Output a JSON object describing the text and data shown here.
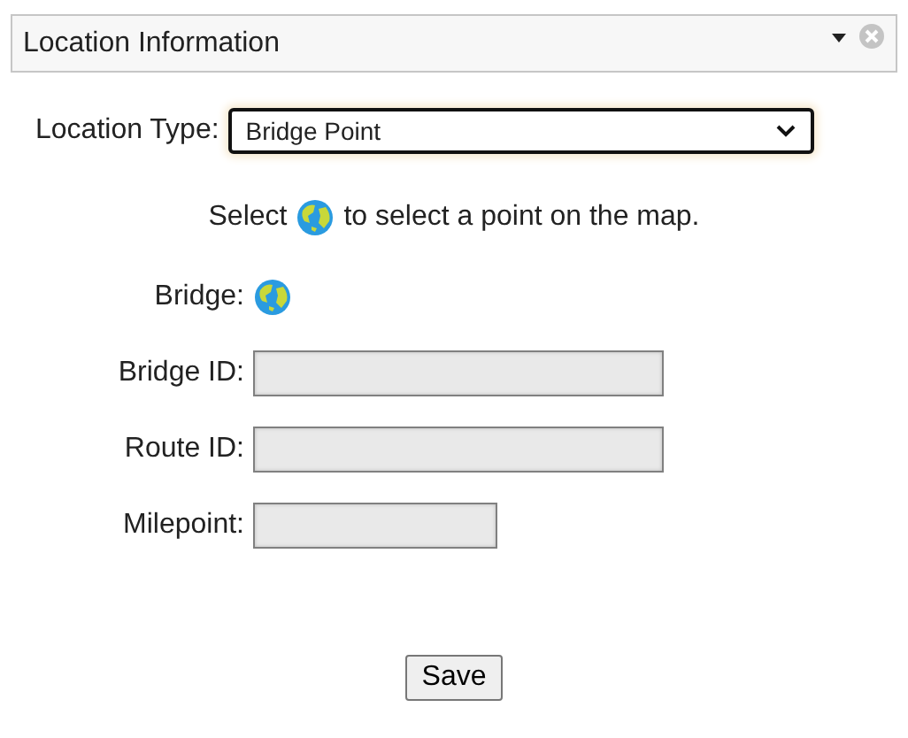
{
  "panel": {
    "title": "Location Information"
  },
  "location_type": {
    "label": "Location Type:",
    "value": "Bridge Point"
  },
  "instruction": {
    "before": "Select",
    "after": "to select a point on the map."
  },
  "bridge": {
    "label": "Bridge:"
  },
  "fields": [
    {
      "label": "Bridge ID:",
      "kind": "long"
    },
    {
      "label": "Route ID:",
      "kind": "long"
    },
    {
      "label": "Milepoint:",
      "kind": "short"
    }
  ],
  "buttons": [
    "Save"
  ]
}
